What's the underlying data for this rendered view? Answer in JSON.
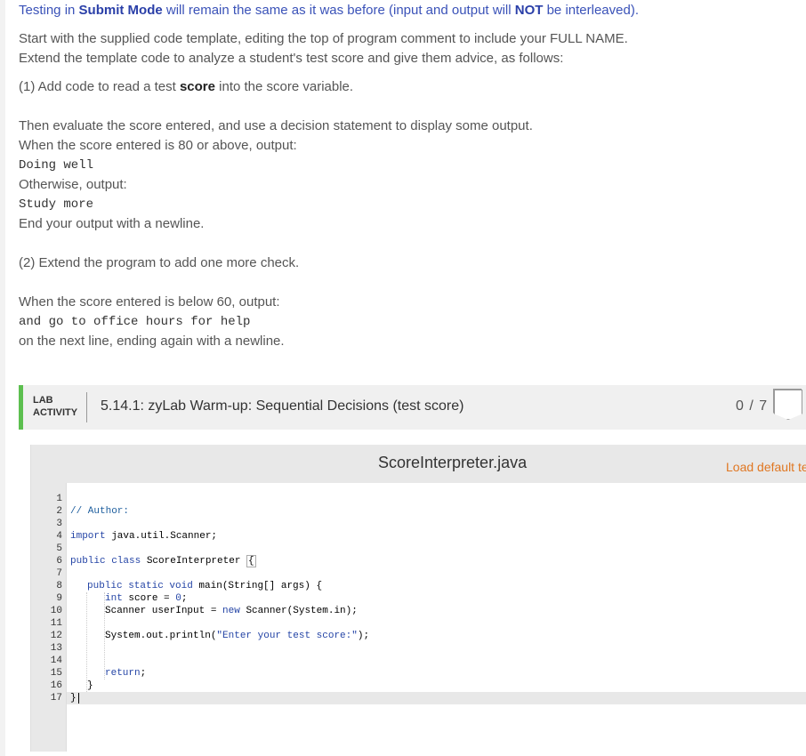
{
  "instructions": {
    "line1": {
      "pre": "Testing in ",
      "b1": "Submit Mode",
      "mid": " will remain the same as it was before (input and output will ",
      "b2": "NOT",
      "post": " be interleaved)."
    },
    "line2": "Start with the supplied code template, editing the top of program comment to include your FULL NAME.",
    "line3": "Extend the template code to analyze a student's test score and give them advice, as follows:",
    "step1": {
      "pre": "(1) Add code to read a test ",
      "kw": "score",
      "post": " into the score variable."
    },
    "line4": "Then evaluate the score entered, and use a decision statement to display some output.",
    "line5": "When the score entered is 80 or above, output:",
    "out1": "Doing well",
    "line6": "Otherwise, output:",
    "out2": "Study more",
    "line7": "End your output with a newline.",
    "step2": "(2) Extend the program to add one more check.",
    "line8": "When the score entered is below 60, output:",
    "out3": "and go to office hours for help",
    "line9": "on the next line, ending again with a newline."
  },
  "lab": {
    "tag_line1": "LAB",
    "tag_line2": "ACTIVITY",
    "title": "5.14.1: zyLab Warm-up: Sequential Decisions (test score)",
    "score": "0 / 7"
  },
  "editor": {
    "file_name": "ScoreInterpreter.java",
    "load_default": "Load default te",
    "line_numbers": [
      "1",
      "2",
      "3",
      "4",
      "5",
      "6",
      "7",
      "8",
      "9",
      "10",
      "11",
      "12",
      "13",
      "14",
      "15",
      "16",
      "17"
    ],
    "code": {
      "l2": "// Author:",
      "l4_kw": "import",
      "l4_rest": " java.util.Scanner;",
      "l6_kw": "public class",
      "l6_rest": " ScoreInterpreter ",
      "l6_brace": "{",
      "l8_kw": "public static void",
      "l8_rest": " main(String[] args) {",
      "l9_kw": "int",
      "l9_rest": " score = ",
      "l9_num": "0",
      "l9_end": ";",
      "l10_a": "Scanner userInput = ",
      "l10_kw": "new",
      "l10_b": " Scanner(System.in);",
      "l12_a": "System.out.println(",
      "l12_str": "\"Enter your test score:\"",
      "l12_b": ");",
      "l15_kw": "return",
      "l15_rest": ";",
      "l16": "}",
      "l17": "}"
    }
  }
}
